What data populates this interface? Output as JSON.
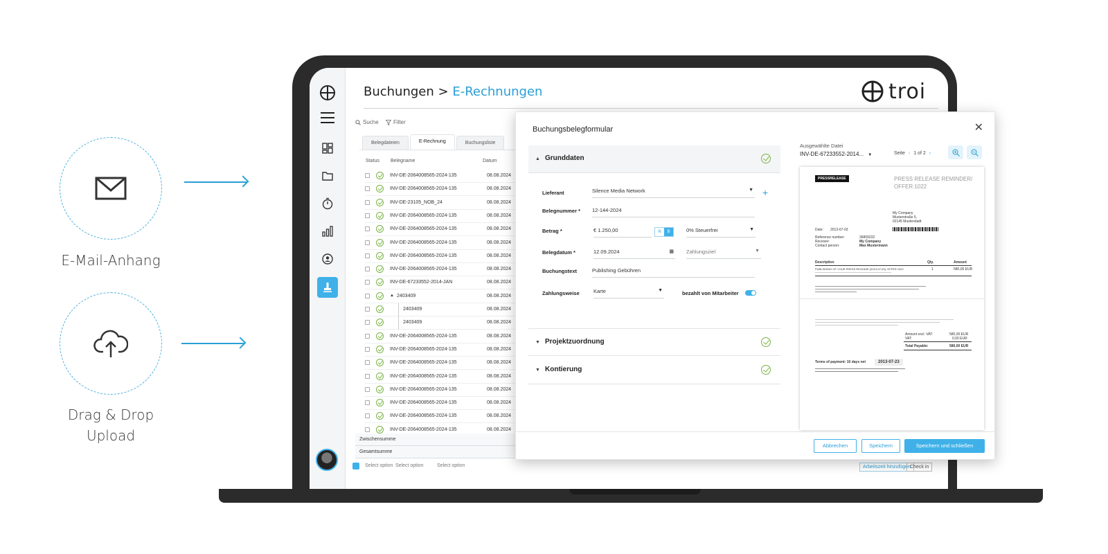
{
  "left": {
    "email_label": "E-Mail-Anhang",
    "upload_label_line1": "Drag & Drop",
    "upload_label_line2": "Upload"
  },
  "header": {
    "crumb1": "Buchungen",
    "separator": ">",
    "crumb2": "E-Rechnungen",
    "brand": "troi"
  },
  "toolbar": {
    "search": "Suche",
    "filter": "Filter"
  },
  "tabs": [
    "Belegdateien",
    "E-Rechnung",
    "Buchungsliste"
  ],
  "table": {
    "headers": [
      "Status",
      "Belegname",
      "Datum"
    ],
    "rows": [
      {
        "name": "INV-DE-2064008565-2024-135",
        "date": "08.08.2024"
      },
      {
        "name": "INV-DE-2064008565-2024-135",
        "date": "08.08.2024"
      },
      {
        "name": "INV-DE-23105_NOB_24",
        "date": "08.08.2024"
      },
      {
        "name": "INV-DE-2064008565-2024-135",
        "date": "08.08.2024"
      },
      {
        "name": "INV-DE-2064008565-2024-135",
        "date": "08.08.2024"
      },
      {
        "name": "INV-DE-2064008565-2024-135",
        "date": "08.08.2024"
      },
      {
        "name": "INV-DE-2064008565-2024-135",
        "date": "08.08.2024"
      },
      {
        "name": "INV-DE-2064008565-2024-135",
        "date": "08.08.2024"
      },
      {
        "name": "INV-DE-67233552-2014-JAN",
        "date": "08.08.2024"
      },
      {
        "name": "2403409",
        "date": "08.08.2024"
      },
      {
        "name": "2403409",
        "date": "08.08.2024"
      },
      {
        "name": "2403409",
        "date": "08.08.2024"
      },
      {
        "name": "INV-DE-2064008565-2024-135",
        "date": "08.08.2024"
      },
      {
        "name": "INV-DE-2064008565-2024-135",
        "date": "08.08.2024"
      },
      {
        "name": "INV-DE-2064008565-2024-135",
        "date": "08.08.2024"
      },
      {
        "name": "INV-DE-2064008565-2024-135",
        "date": "08.08.2024"
      },
      {
        "name": "INV-DE-2064008565-2024-135",
        "date": "08.08.2024"
      },
      {
        "name": "INV-DE-2064008565-2024-135",
        "date": "08.08.2024"
      },
      {
        "name": "INV-DE-2064008565-2024-135",
        "date": "08.08.2024"
      },
      {
        "name": "INV-DE-2064008565-2024-135",
        "date": "08.08.2024"
      }
    ],
    "subtotal": "Zwischensumme",
    "total": "Gesamtsumme"
  },
  "bottom": {
    "select1": "Select option",
    "select2": "Select option",
    "select3": "Select option",
    "btn_time": "Arbeitszeit hinzufügen",
    "btn_checkin": "Check in"
  },
  "modal": {
    "title": "Buchungsbelegformular",
    "sections": {
      "grunddaten": "Grunddaten",
      "projekt": "Projektzuordnung",
      "kontierung": "Kontierung"
    },
    "fields": {
      "lieferant_label": "Lieferant",
      "lieferant_value": "Silence Media Network",
      "belegnummer_label": "Belegnummer *",
      "belegnummer_value": "12-144-2024",
      "betrag_label": "Betrag *",
      "betrag_value": "€ 1.250,00",
      "n_label": "N",
      "b_label": "B",
      "steuer_value": "0% Steuerfrei",
      "belegdatum_label": "Belegdatum *",
      "belegdatum_value": "12.09.2024",
      "zahlungsziel_placeholder": "Zahlungsziel",
      "buchungstext_label": "Buchungstext",
      "buchungstext_value": "Publishing Gebühren",
      "zahlungsweise_label": "Zahlungsweise",
      "zahlungsweise_value": "Karte",
      "bezahlt_label": "bezahlt von Mitarbeiter"
    },
    "file": {
      "label": "Ausgewählte Datei",
      "name": "INV-DE-67233552-2014...",
      "page_label": "Seite",
      "page_value": "1 of 2"
    },
    "buttons": {
      "cancel": "Abbrechen",
      "save": "Speichern",
      "save_close": "Speichern und schließen"
    }
  },
  "document": {
    "logo": "PRESSRELEASE",
    "heading1": "PRESS RELEASE REMINDER/",
    "heading2": "OFFER:1022",
    "address1": "My Company",
    "address2": "Musterstraße 5,",
    "address3": "02145 Musterstadt",
    "date_label": "Date:",
    "date_value": "2013-07-03",
    "ref_label": "Reference number:",
    "ref_value": "36809232",
    "receiver_label": "Receiver:",
    "receiver_value": "My Company",
    "contact_label": "Contact person:",
    "contact_value": "Max Mustermann",
    "col_description": "Description",
    "col_qty": "Qty.",
    "col_amount": "Amount",
    "item_desc": "PUBLISHING OF YOUR PRESS RELEASE (2013-07-03), OFFER 1022",
    "item_qty": "1",
    "item_amount": "580,00 EUR",
    "amount_excl_label": "Amount excl. VAT:",
    "amount_excl_value": "580,00 EUR",
    "vat_label": "VAT:",
    "vat_value": "0,00 EUR",
    "total_label": "Total Payable:",
    "total_value": "580,00 EUR",
    "terms_label": "Terms of payment: 10 days net",
    "terms_date": "2013-07-23"
  },
  "colors": {
    "accent": "#3fb1e8",
    "ok_green": "#79b344",
    "dark_frame": "#2b2b2b"
  }
}
